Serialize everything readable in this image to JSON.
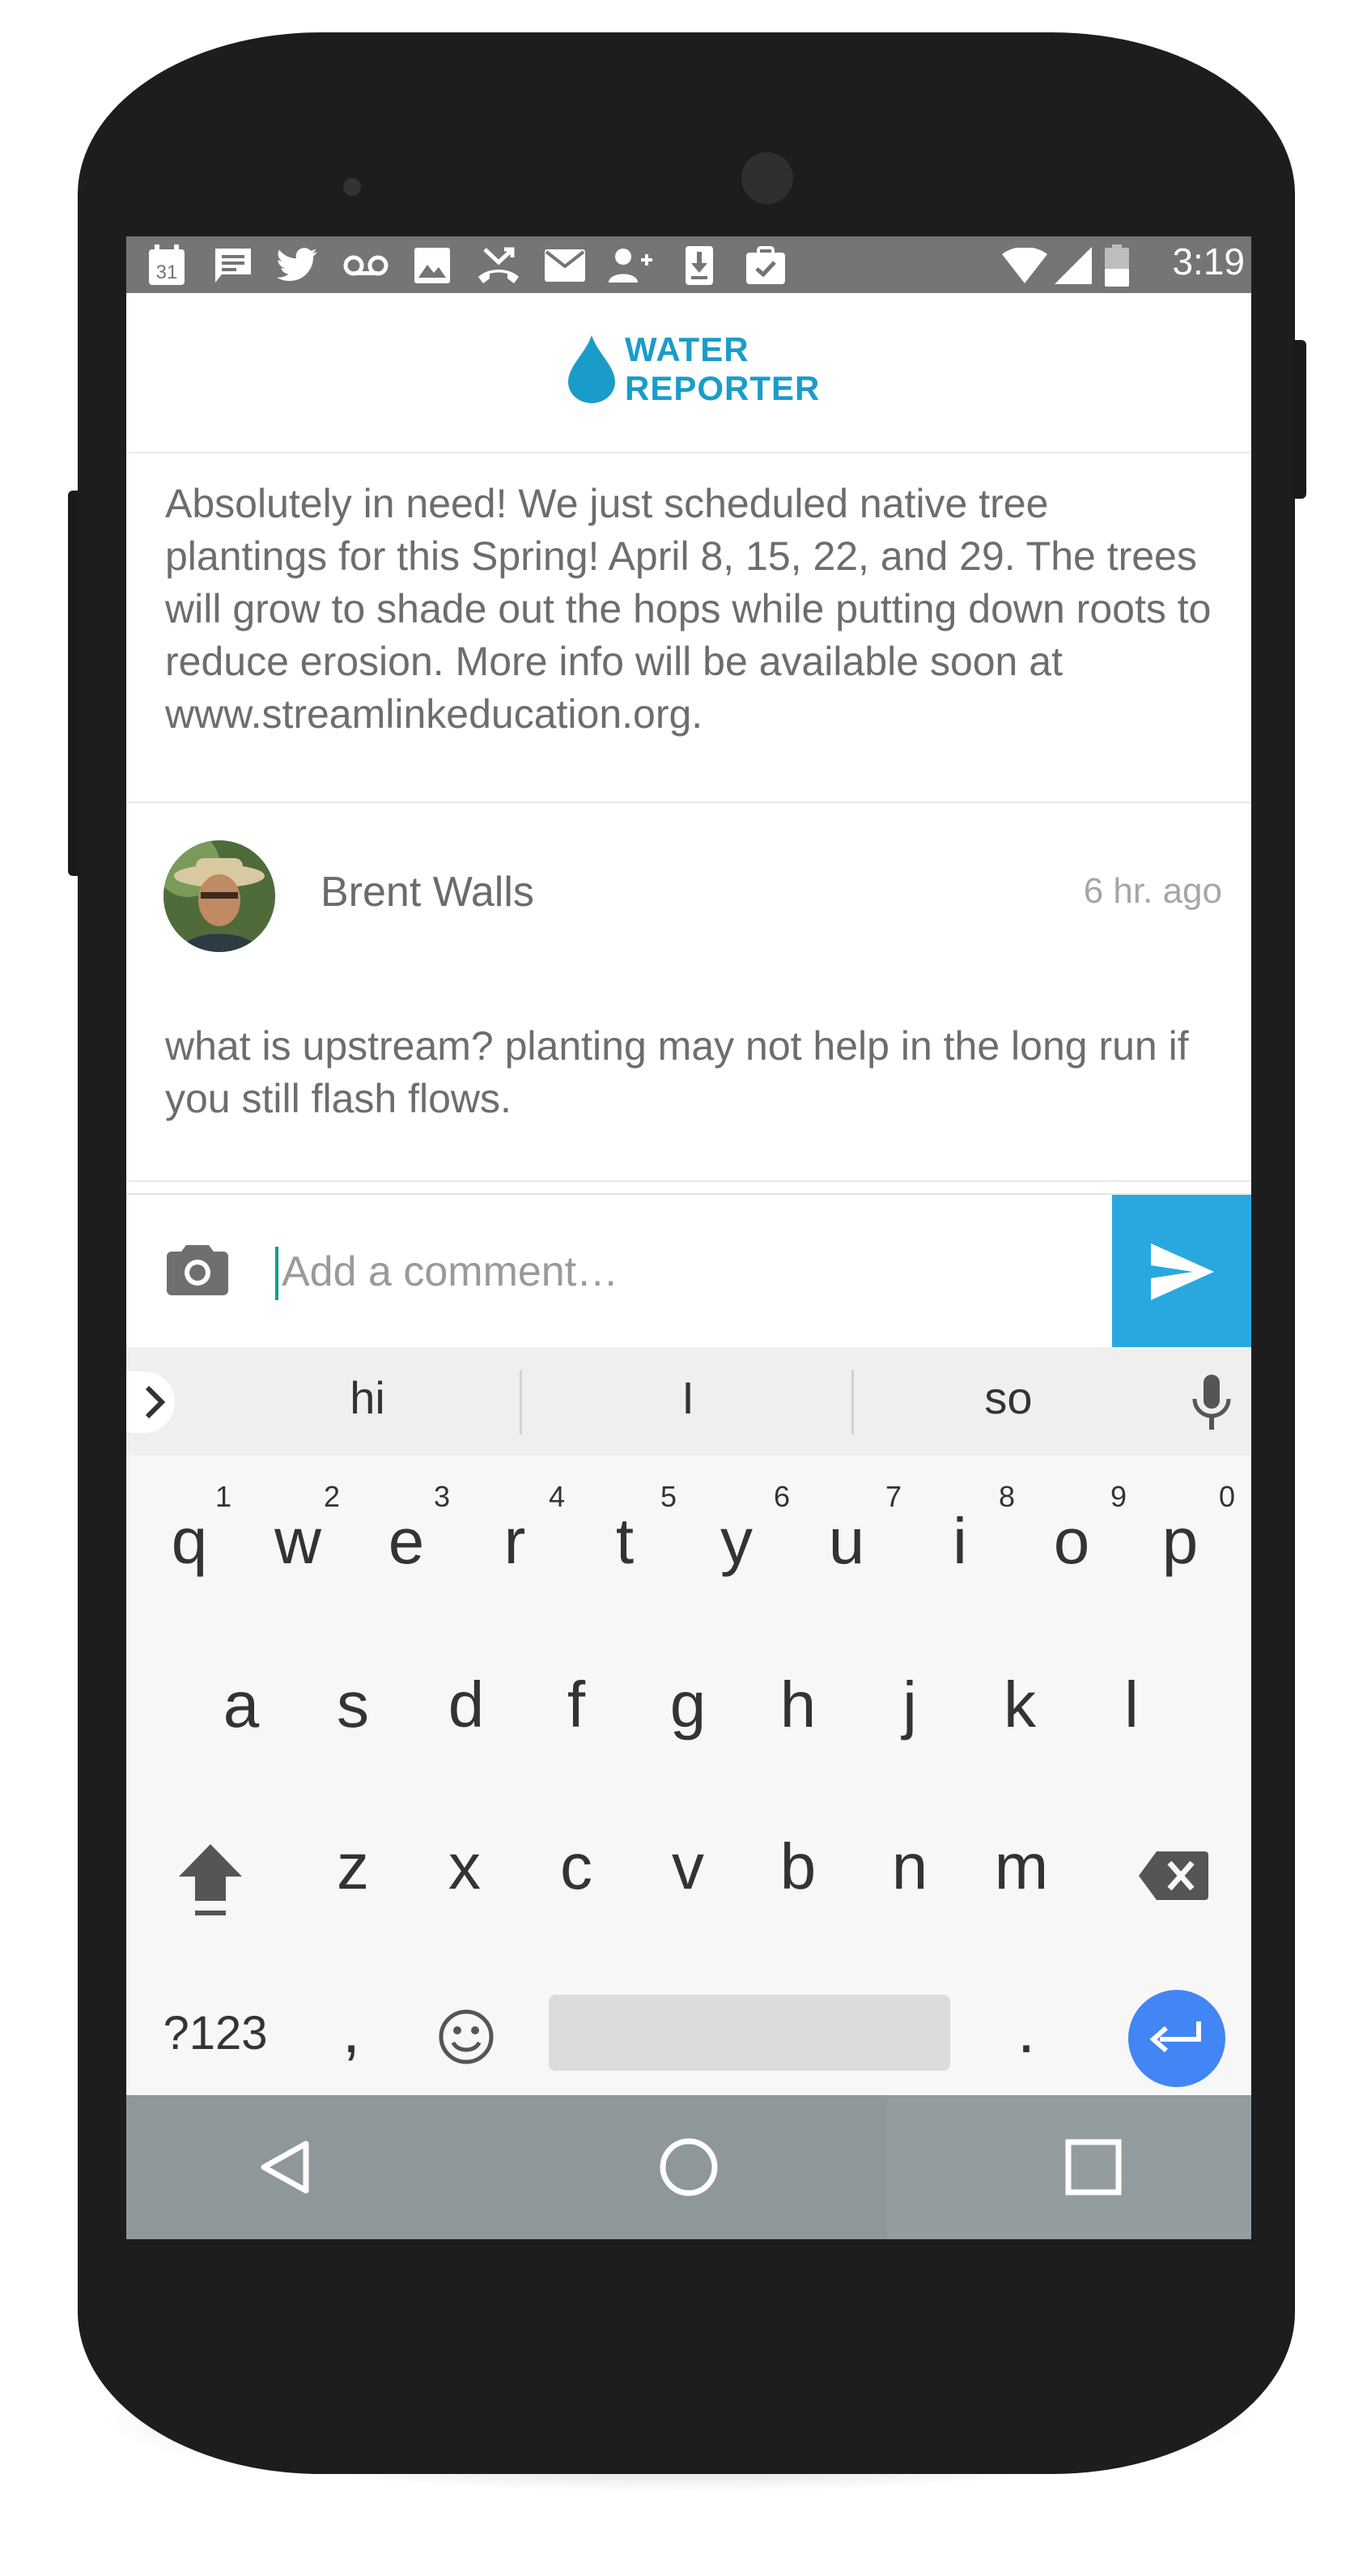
{
  "status_bar": {
    "time": "3:19",
    "icons": [
      "calendar-icon",
      "message-icon",
      "twitter-icon",
      "voicemail-icon",
      "image-icon",
      "missed-call-icon",
      "email-icon",
      "add-contact-icon",
      "download-icon",
      "tasks-icon",
      "wifi-icon",
      "signal-icon",
      "battery-icon"
    ],
    "calendar_day": "31"
  },
  "app": {
    "logo_line1": "WATER",
    "logo_line2": "REPORTER",
    "brand_color": "#1a9cc9"
  },
  "feed": {
    "comments": [
      {
        "text": "Absolutely in need! We just scheduled native tree plantings for this Spring! April  8, 15, 22, and 29. The trees will grow to shade out the hops while putting down roots to reduce erosion. More info will be available soon at www.streamlinkeducation.org."
      },
      {
        "author": "Brent Walls",
        "time": "6 hr. ago",
        "text": "what is upstream? planting may not help in the long run if you still flash flows."
      }
    ]
  },
  "composer": {
    "placeholder": "Add a comment…",
    "send_color": "#29a8e0"
  },
  "keyboard": {
    "suggestions": [
      "hi",
      "I",
      "so"
    ],
    "row1": [
      "q",
      "w",
      "e",
      "r",
      "t",
      "y",
      "u",
      "i",
      "o",
      "p"
    ],
    "row1_hints": [
      "1",
      "2",
      "3",
      "4",
      "5",
      "6",
      "7",
      "8",
      "9",
      "0"
    ],
    "row2": [
      "a",
      "s",
      "d",
      "f",
      "g",
      "h",
      "j",
      "k",
      "l"
    ],
    "row3": [
      "z",
      "x",
      "c",
      "v",
      "b",
      "n",
      "m"
    ],
    "symbols_label": "?123",
    "comma": ",",
    "period": ".",
    "enter_color": "#4285f4"
  }
}
